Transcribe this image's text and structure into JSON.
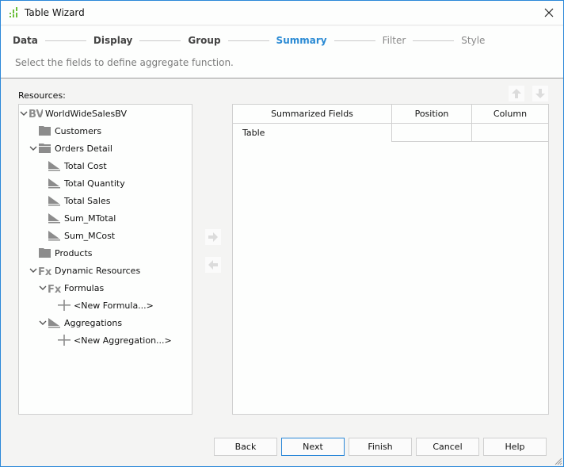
{
  "window": {
    "title": "Table Wizard",
    "app_icon": "table-wizard-icon",
    "close_icon": "close-icon"
  },
  "steps": [
    {
      "label": "Data",
      "state": "done"
    },
    {
      "label": "Display",
      "state": "done"
    },
    {
      "label": "Group",
      "state": "done"
    },
    {
      "label": "Summary",
      "state": "active"
    },
    {
      "label": "Filter",
      "state": "future"
    },
    {
      "label": "Style",
      "state": "future"
    }
  ],
  "subtitle": "Select the fields to define aggregate function.",
  "resources": {
    "label": "Resources:",
    "tree": [
      {
        "label": "WorldWideSalesBV",
        "icon": "business-view-icon",
        "expanded": true
      },
      {
        "label": "Customers",
        "icon": "folder-icon"
      },
      {
        "label": "Orders Detail",
        "icon": "folder-open-icon",
        "expanded": true
      },
      {
        "label": "Total Cost",
        "icon": "aggregation-icon"
      },
      {
        "label": "Total Quantity",
        "icon": "aggregation-icon"
      },
      {
        "label": "Total Sales",
        "icon": "aggregation-icon"
      },
      {
        "label": "Sum_MTotal",
        "icon": "aggregation-icon"
      },
      {
        "label": "Sum_MCost",
        "icon": "aggregation-icon"
      },
      {
        "label": "Products",
        "icon": "folder-icon"
      },
      {
        "label": "Dynamic Resources",
        "icon": "formula-icon",
        "expanded": true
      },
      {
        "label": "Formulas",
        "icon": "formula-icon",
        "expanded": true
      },
      {
        "label": "<New Formula...>",
        "icon": "add-icon"
      },
      {
        "label": "Aggregations",
        "icon": "aggregation-icon",
        "expanded": true
      },
      {
        "label": "<New Aggregation...>",
        "icon": "add-icon"
      }
    ]
  },
  "transfer": {
    "add_icon": "arrow-right-icon",
    "remove_icon": "arrow-left-icon"
  },
  "order": {
    "up_icon": "arrow-up-icon",
    "down_icon": "arrow-down-icon"
  },
  "summary_table": {
    "columns": [
      "Summarized Fields",
      "Position",
      "Column"
    ],
    "rows": [
      {
        "field": "Table",
        "position": "",
        "column": ""
      }
    ]
  },
  "buttons": {
    "back": "Back",
    "next": "Next",
    "finish": "Finish",
    "cancel": "Cancel",
    "help": "Help"
  },
  "colors": {
    "accent": "#2a8ad4",
    "icon_gray": "#8c8c8c",
    "app_icon_green": "#6cbf3a"
  }
}
